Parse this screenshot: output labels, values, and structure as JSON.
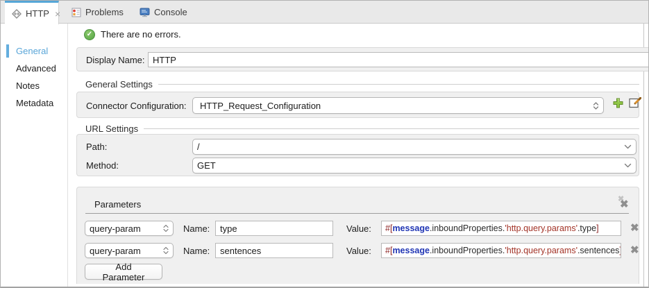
{
  "tabs": [
    {
      "label": "HTTP",
      "icon": "http-connector-icon",
      "active": true,
      "closable": true
    },
    {
      "label": "Problems",
      "icon": "problems-icon",
      "active": false,
      "closable": false
    },
    {
      "label": "Console",
      "icon": "console-icon",
      "active": false,
      "closable": false
    }
  ],
  "sidebar": {
    "items": [
      {
        "label": "General",
        "selected": true
      },
      {
        "label": "Advanced",
        "selected": false
      },
      {
        "label": "Notes",
        "selected": false
      },
      {
        "label": "Metadata",
        "selected": false
      }
    ]
  },
  "status": {
    "message": "There are no errors."
  },
  "display_name": {
    "label": "Display Name:",
    "value": "HTTP"
  },
  "general_settings": {
    "title": "General Settings",
    "connector_config_label": "Connector Configuration:",
    "connector_config_value": "HTTP_Request_Configuration"
  },
  "url_settings": {
    "title": "URL Settings",
    "path_label": "Path:",
    "path_value": "/",
    "method_label": "Method:",
    "method_value": "GET"
  },
  "parameters": {
    "title": "Parameters",
    "name_label": "Name:",
    "value_label": "Value:",
    "add_button_label": "Add Parameter",
    "rows": [
      {
        "type": "query-param",
        "name": "type",
        "value": "#[message.inboundProperties.'http.query.params'.type]",
        "value_segments": [
          {
            "c": "p",
            "t": "#["
          },
          {
            "c": "k",
            "t": "message"
          },
          {
            "c": "t",
            "t": ".inboundProperties."
          },
          {
            "c": "s",
            "t": "'http.query.params'"
          },
          {
            "c": "t",
            "t": ".type"
          },
          {
            "c": "p",
            "t": "]"
          }
        ]
      },
      {
        "type": "query-param",
        "name": "sentences",
        "value": "#[message.inboundProperties.'http.query.params'.sentences]",
        "value_segments": [
          {
            "c": "p",
            "t": "#["
          },
          {
            "c": "k",
            "t": "message"
          },
          {
            "c": "t",
            "t": ".inboundProperties."
          },
          {
            "c": "s",
            "t": "'http.query.params'"
          },
          {
            "c": "t",
            "t": ".sentences"
          },
          {
            "c": "p",
            "t": "]"
          }
        ]
      }
    ]
  },
  "glyphs": {
    "close": "×",
    "check": "✓",
    "delete_x": "✖"
  },
  "colors": {
    "active_tab_accent": "#56a6d7",
    "sidebar_selected": "#58a5d8",
    "status_green": "#55a444",
    "expr_keyword": "#2136b5",
    "expr_string": "#a33327",
    "expr_punct": "#8b2020",
    "add_icon_green": "#8fc646"
  }
}
